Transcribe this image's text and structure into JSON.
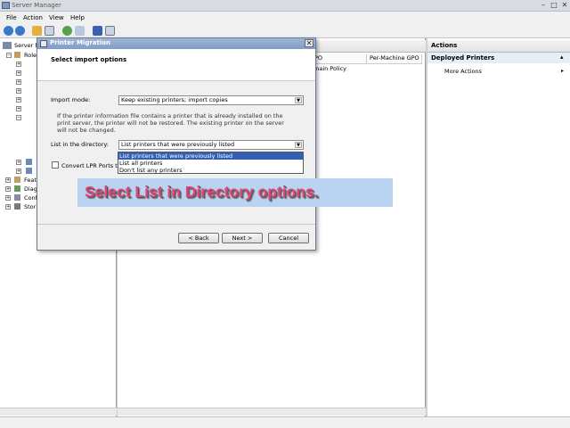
{
  "app": {
    "title": "Server Manager"
  },
  "window_controls": {
    "minimize": "–",
    "maximize": "□",
    "close": "✕"
  },
  "menus": [
    "File",
    "Action",
    "View",
    "Help"
  ],
  "tree": {
    "items": [
      "Server M",
      "Role",
      "Feat",
      "Diag",
      "Conf",
      "Stor"
    ]
  },
  "center": {
    "columns": [
      "PO",
      "Per-Machine GPO"
    ],
    "cell": "main Policy"
  },
  "actions": {
    "header": "Actions",
    "section": "Deployed Printers",
    "more": "More Actions"
  },
  "dialog": {
    "title": "Printer Migration",
    "heading": "Select import options",
    "import_mode_label": "Import mode:",
    "import_mode_value": "Keep existing printers; import copies",
    "info_text": "If the printer information file contains a printer that is already installed on the print server, the printer will not be restored. The existing printer on the server will not be changed.",
    "list_label": "List in the directory:",
    "list_value": "List printers that were previously listed",
    "list_options": [
      "List printers that were previously listed",
      "List all printers",
      "Don't list any printers"
    ],
    "checkbox_label": "Convert LPR Ports to",
    "back": "< Back",
    "next": "Next >",
    "cancel": "Cancel"
  },
  "banner": {
    "text": "Select List in Directory options."
  },
  "colors": {
    "accent": "#3060b8",
    "banner_bg": "#b8d4f0",
    "banner_text": "#e0457b"
  }
}
